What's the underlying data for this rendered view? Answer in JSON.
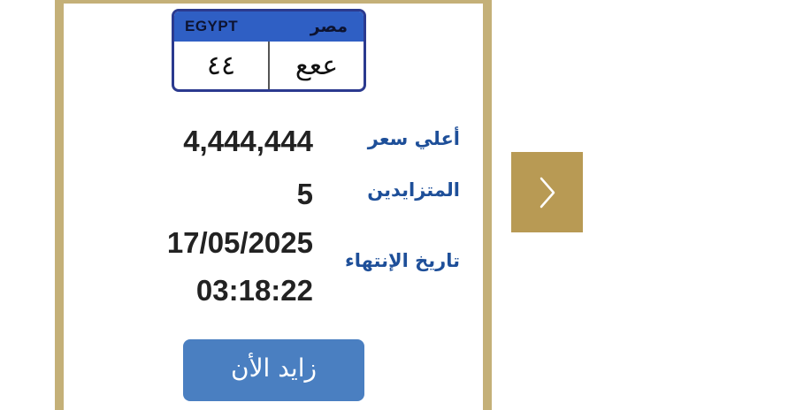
{
  "plate": {
    "country_en": "EGYPT",
    "country_ar": "مصر",
    "numbers": "٤٤",
    "letters": "ععع"
  },
  "details": {
    "highest_price_label": "أعلي سعر",
    "highest_price_value": "4,444,444",
    "bidders_label": "المتزايدين",
    "bidders_value": "5",
    "end_date_label": "تاريخ الإنتهاء",
    "end_date_value": "17/05/2025",
    "end_time_value": "03:18:22"
  },
  "actions": {
    "bid_button_label": "زايد الأن",
    "next_icon": "chevron-right-icon"
  },
  "colors": {
    "card_border": "#c4b078",
    "label_blue": "#1e4f99",
    "button_blue": "#4a7fc1",
    "next_button": "#b89a54",
    "plate_header": "#2f5fc4"
  }
}
